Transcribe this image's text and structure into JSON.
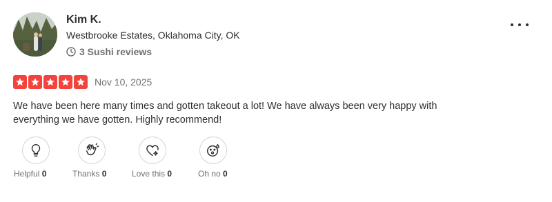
{
  "user": {
    "name": "Kim K.",
    "location": "Westbrooke Estates, Oklahoma City, OK",
    "reviews": "3 Sushi reviews"
  },
  "review": {
    "rating": 5,
    "date": "Nov 10, 2025",
    "text": "We have been here many times and gotten takeout a lot! We have always been very happy with everything we have gotten. Highly recommend!"
  },
  "reactions": [
    {
      "label": "Helpful",
      "count": "0",
      "icon": "lightbulb-icon"
    },
    {
      "label": "Thanks",
      "count": "0",
      "icon": "clapping-hands-icon"
    },
    {
      "label": "Love this",
      "count": "0",
      "icon": "heart-sparkle-icon"
    },
    {
      "label": "Oh no",
      "count": "0",
      "icon": "surprised-face-icon"
    }
  ],
  "colors": {
    "star": "#f4433c",
    "text": "#2d2e2f",
    "muted": "#6e7072"
  }
}
